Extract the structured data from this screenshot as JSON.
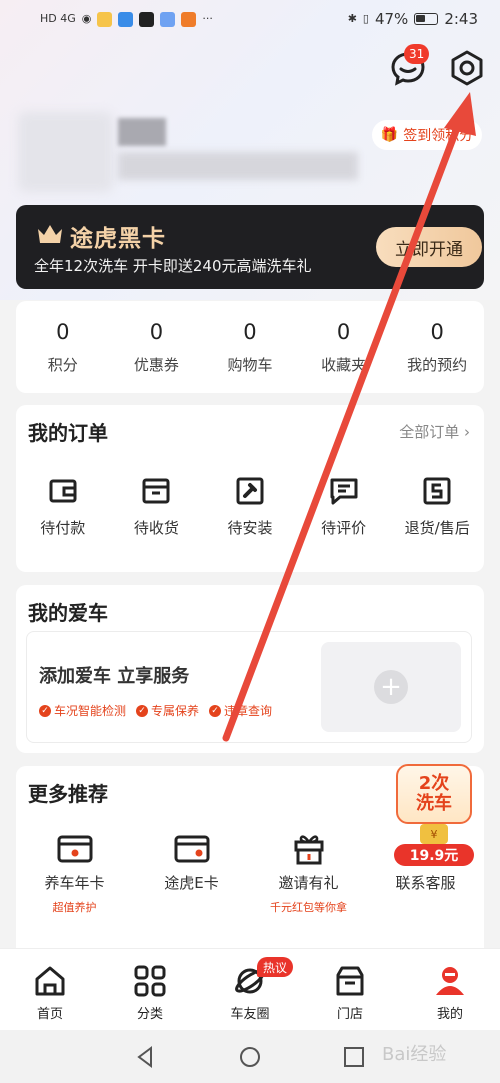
{
  "status_bar": {
    "time": "2:43",
    "battery": "47%",
    "left_tags": "HD 4G"
  },
  "header": {
    "message_badge": "31",
    "checkin_label": "签到领积分"
  },
  "black_card": {
    "title": "途虎黑卡",
    "subtitle": "全年12次洗车 开卡即送240元高端洗车礼",
    "button": "立即开通"
  },
  "stats": [
    {
      "value": "0",
      "label": "积分"
    },
    {
      "value": "0",
      "label": "优惠券"
    },
    {
      "value": "0",
      "label": "购物车"
    },
    {
      "value": "0",
      "label": "收藏夹"
    },
    {
      "value": "0",
      "label": "我的预约"
    }
  ],
  "orders": {
    "title": "我的订单",
    "all_link": "全部订单 ›",
    "items": [
      {
        "label": "待付款",
        "icon": "wallet-icon"
      },
      {
        "label": "待收货",
        "icon": "box-icon"
      },
      {
        "label": "待安装",
        "icon": "wrench-icon"
      },
      {
        "label": "待评价",
        "icon": "comment-icon"
      },
      {
        "label": "退货/售后",
        "icon": "return-icon"
      }
    ]
  },
  "my_car": {
    "title": "我的爱车",
    "add_title": "添加爱车 立享服务",
    "tags": [
      "车况智能检测",
      "专属保养",
      "违章查询"
    ],
    "add_symbol": "+"
  },
  "more": {
    "title": "更多推荐",
    "items": [
      {
        "label": "养车年卡",
        "sub": "超值养护",
        "icon": "card-icon"
      },
      {
        "label": "途虎E卡",
        "sub": "",
        "icon": "ecard-icon"
      },
      {
        "label": "邀请有礼",
        "sub": "千元红包等你拿",
        "icon": "gift-icon"
      },
      {
        "label": "联系客服",
        "sub": "",
        "icon": "promo-badge"
      }
    ],
    "promo": {
      "line1": "2次",
      "line2": "洗车",
      "coin": "¥",
      "price": "19.9元"
    }
  },
  "tabbar": {
    "items": [
      {
        "label": "首页",
        "icon": "home-icon"
      },
      {
        "label": "分类",
        "icon": "grid-icon"
      },
      {
        "label": "车友圈",
        "icon": "planet-icon",
        "badge": "热议"
      },
      {
        "label": "门店",
        "icon": "store-icon"
      },
      {
        "label": "我的",
        "icon": "user-icon"
      }
    ],
    "active": "我的"
  },
  "colors": {
    "accent": "#e4431c",
    "gold": "#f4d2a8",
    "dark": "#1f1f22",
    "arrow": "#e8493a"
  },
  "watermark": "Bai经验"
}
